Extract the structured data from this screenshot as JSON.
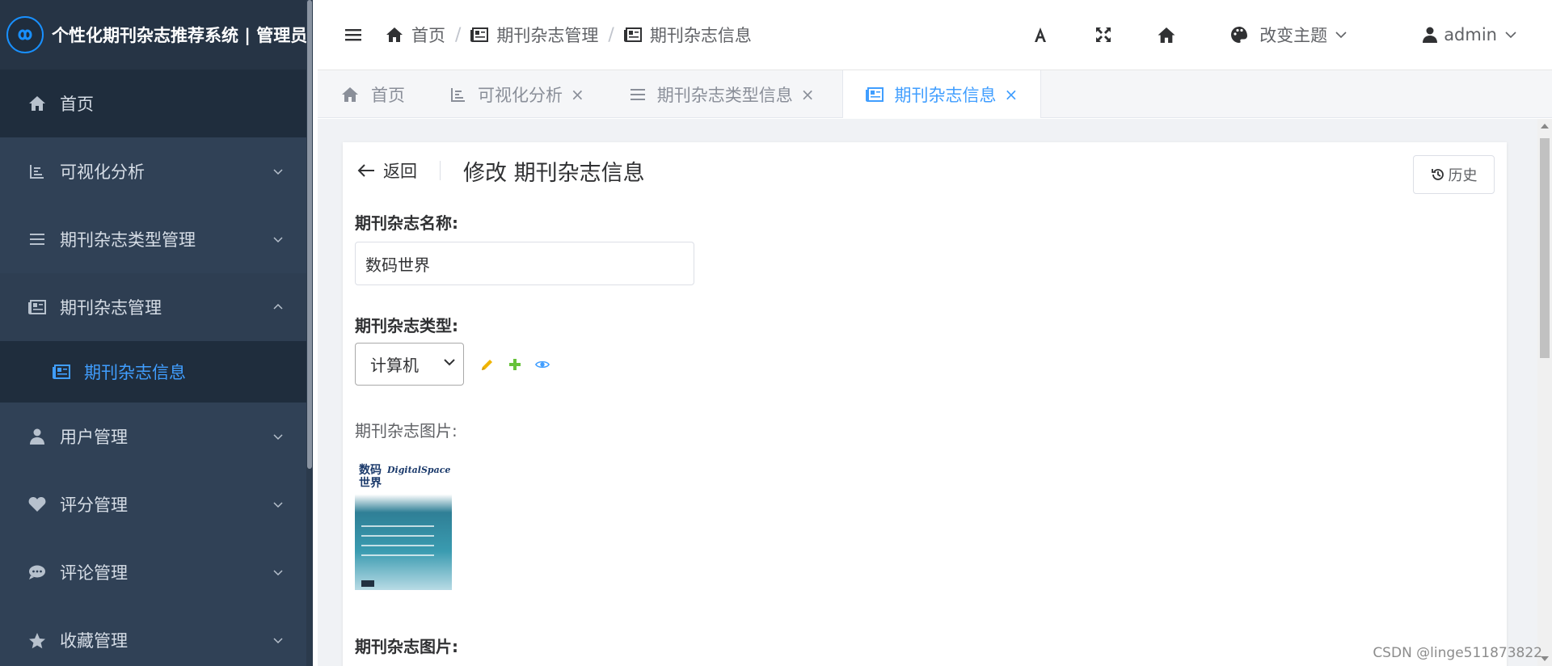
{
  "app": {
    "title": "个性化期刊杂志推荐系统 | 管理员"
  },
  "sidebar": {
    "items": [
      {
        "label": "首页",
        "icon": "home-icon",
        "state": "active"
      },
      {
        "label": "可视化分析",
        "icon": "chart-icon",
        "state": "collapsed"
      },
      {
        "label": "期刊杂志类型管理",
        "icon": "list-icon",
        "state": "collapsed"
      },
      {
        "label": "期刊杂志管理",
        "icon": "newspaper-icon",
        "state": "expanded"
      },
      {
        "label": "用户管理",
        "icon": "user-icon",
        "state": "collapsed"
      },
      {
        "label": "评分管理",
        "icon": "heart-icon",
        "state": "collapsed"
      },
      {
        "label": "评论管理",
        "icon": "comment-icon",
        "state": "collapsed"
      },
      {
        "label": "收藏管理",
        "icon": "star-icon",
        "state": "collapsed"
      }
    ],
    "submenu": {
      "label": "期刊杂志信息",
      "icon": "newspaper-icon"
    }
  },
  "header": {
    "breadcrumb": [
      {
        "label": "首页",
        "icon": "home-icon"
      },
      {
        "label": "期刊杂志管理",
        "icon": "newspaper-icon"
      },
      {
        "label": "期刊杂志信息",
        "icon": "newspaper-icon"
      }
    ],
    "theme_label": "改变主题",
    "user_label": "admin"
  },
  "tabs": [
    {
      "label": "首页",
      "icon": "home-icon",
      "closable": false,
      "active": false
    },
    {
      "label": "可视化分析",
      "icon": "chart-icon",
      "closable": true,
      "active": false
    },
    {
      "label": "期刊杂志类型信息",
      "icon": "list-icon",
      "closable": true,
      "active": false
    },
    {
      "label": "期刊杂志信息",
      "icon": "newspaper-icon",
      "closable": true,
      "active": true
    }
  ],
  "page": {
    "back_label": "返回",
    "title": "修改 期刊杂志信息",
    "history_label": "历史"
  },
  "form": {
    "name_label": "期刊杂志名称:",
    "name_value": "数码世界",
    "type_label": "期刊杂志类型:",
    "type_value": "计算机",
    "image_label_light": "期刊杂志图片:",
    "image_label_bold": "期刊杂志图片:",
    "cover": {
      "title_cn": "数码\n世界",
      "title_en": "DigitalSpace"
    }
  },
  "watermark": "CSDN @linge511873822",
  "colors": {
    "sidebar_bg": "#304156",
    "accent": "#409eff",
    "edit_icon": "#f0b400",
    "add_icon": "#67c23a",
    "view_icon": "#409eff"
  }
}
